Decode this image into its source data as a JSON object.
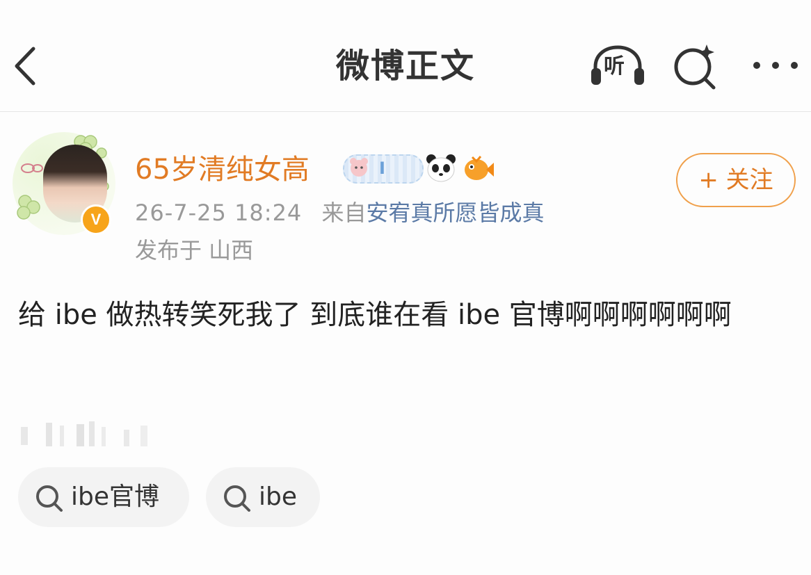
{
  "header": {
    "title": "微博正文",
    "listen_label": "听"
  },
  "post": {
    "author": {
      "name": "65岁清纯女高",
      "badge_text": "I",
      "verified_mark": "V"
    },
    "follow_label": "+ 关注",
    "time": "26-7-25 18:24",
    "source_prefix": "来自",
    "source": "安宥真所愿皆成真",
    "location": "发布于 山西",
    "text": "给 ibe 做热转笑死我了 到底谁在看 ibe 官博啊啊啊啊啊啊",
    "topics": [
      {
        "label": "ibe官博"
      },
      {
        "label": "ibe"
      }
    ]
  },
  "colors": {
    "accent": "#e17b24",
    "link": "#5b7aa6",
    "muted": "#999999"
  }
}
